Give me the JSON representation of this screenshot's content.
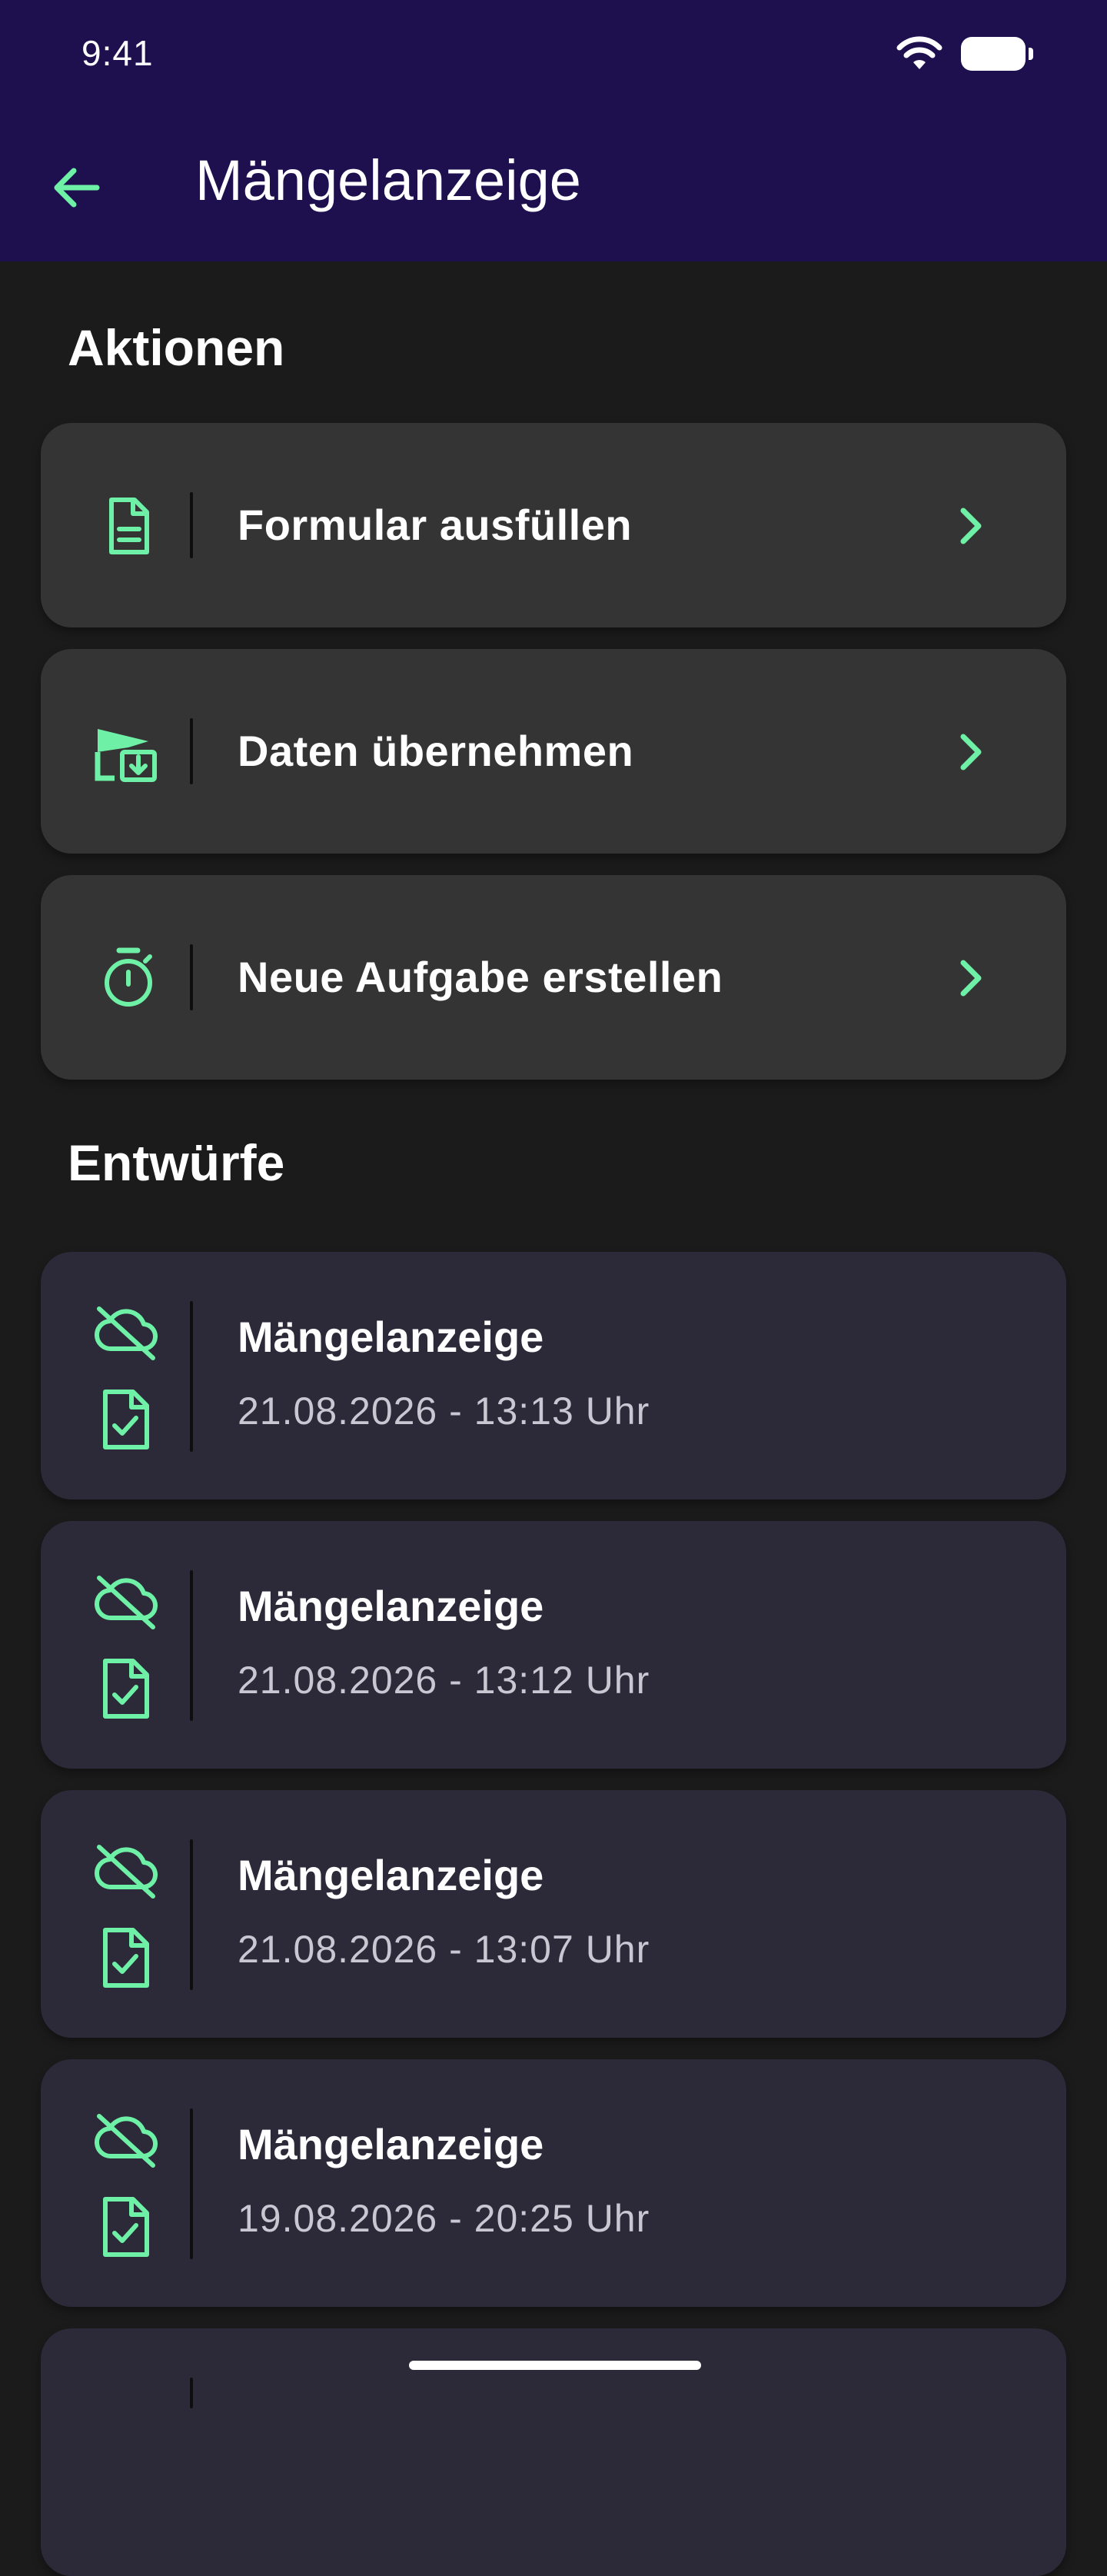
{
  "status_bar": {
    "time": "9:41"
  },
  "app_bar": {
    "title": "Mängelanzeige",
    "back_icon": "arrow-left-icon"
  },
  "colors": {
    "accent": "#6ef0a6",
    "app_bar_bg": "#1e0f4f",
    "background": "#1b1b1b",
    "action_card_bg": "#343434",
    "draft_card_bg": "#2c2939"
  },
  "actions": {
    "heading": "Aktionen",
    "items": [
      {
        "label": "Formular ausfüllen",
        "icon": "document-icon"
      },
      {
        "label": "Daten übernehmen",
        "icon": "transfer-download-icon"
      },
      {
        "label": "Neue Aufgabe erstellen",
        "icon": "stopwatch-icon"
      }
    ]
  },
  "drafts": {
    "heading": "Entwürfe",
    "items": [
      {
        "title": "Mängelanzeige",
        "date": "21.08.2026 - 13:13 Uhr"
      },
      {
        "title": "Mängelanzeige",
        "date": "21.08.2026 - 13:12 Uhr"
      },
      {
        "title": "Mängelanzeige",
        "date": "21.08.2026 - 13:07 Uhr"
      },
      {
        "title": "Mängelanzeige",
        "date": "19.08.2026 - 20:25 Uhr"
      }
    ]
  }
}
